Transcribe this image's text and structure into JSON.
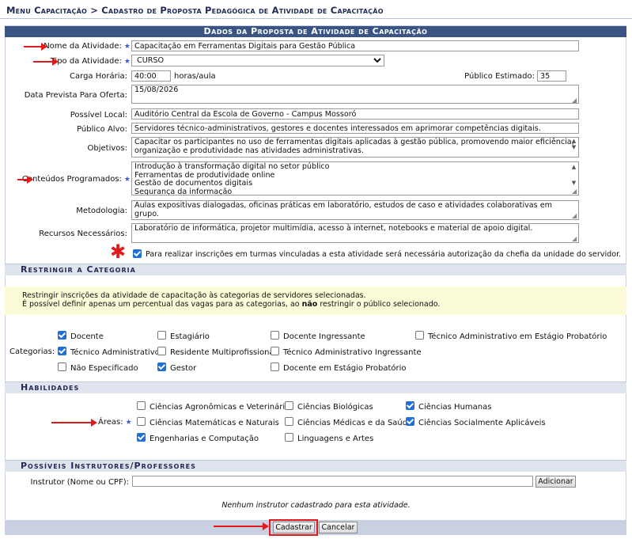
{
  "breadcrumb": "Menu Capacitação > Cadastro de Proposta Pedagógica de Atividade de Capacitação",
  "form": {
    "caption": "Dados da Proposta de Atividade de Capacitação",
    "required_marker": "★",
    "nome": {
      "label": "Nome da Atividade:",
      "value": "Capacitação em Ferramentas Digitais para Gestão Pública"
    },
    "tipo": {
      "label": "Tipo da Atividade:",
      "value": "CURSO"
    },
    "carga": {
      "label": "Carga Horária:",
      "value": "40:00",
      "unit": "horas/aula"
    },
    "publico_estimado": {
      "label": "Público Estimado:",
      "value": "35"
    },
    "data_prevista": {
      "label": "Data Prevista Para Oferta:",
      "value": "15/08/2026"
    },
    "local": {
      "label": "Possível Local:",
      "value": "Auditório Central da Escola de Governo - Campus Mossoró"
    },
    "publico_alvo": {
      "label": "Público Alvo:",
      "value": "Servidores técnico-administrativos, gestores e docentes interessados em aprimorar competências digitais."
    },
    "objetivos": {
      "label": "Objetivos:",
      "value": "Capacitar os participantes no uso de ferramentas digitais aplicadas à gestão pública, promovendo maior eficiência,\norganização e produtividade nas atividades administrativas."
    },
    "conteudos": {
      "label": "Conteúdos Programados:",
      "value": "Introdução à transformação digital no setor público\nFerramentas de produtividade online\nGestão de documentos digitais\nSegurança da informação"
    },
    "metodologia": {
      "label": "Metodologia:",
      "value": "Aulas expositivas dialogadas, oficinas práticas em laboratório, estudos de caso e atividades colaborativas em grupo."
    },
    "recursos": {
      "label": "Recursos Necessários:",
      "value": "Laboratório de informática, projetor multimídia, acesso à internet, notebooks e material de apoio digital."
    },
    "autorizacao": {
      "label": "Para realizar inscrições em turmas vinculadas a esta atividade será necessária autorização da chefia da unidade do servidor.",
      "checked": true
    }
  },
  "restringir": {
    "title": "Restringir a Categoria",
    "notice_line1": "Restringir inscrições da atividade de capacitação às categorias de servidores selecionadas.",
    "notice_line2_pre": "É possível definir apenas um percentual das vagas para as categorias, ao ",
    "notice_line2_bold": "não",
    "notice_line2_post": " restringir o público selecionado.",
    "categorias_label": "Categorias:",
    "options": [
      {
        "label": "Docente",
        "checked": true
      },
      {
        "label": "Estagiário",
        "checked": false
      },
      {
        "label": "Docente Ingressante",
        "checked": false
      },
      {
        "label": "Técnico Administrativo em Estágio Probatório",
        "checked": false
      },
      {
        "label": "Técnico Administrativo",
        "checked": true
      },
      {
        "label": "Residente Multiprofissional",
        "checked": false
      },
      {
        "label": "Técnico Administrativo Ingressante",
        "checked": false
      },
      {
        "label": "Não Especificado",
        "checked": false
      },
      {
        "label": "Gestor",
        "checked": true
      },
      {
        "label": "Docente em Estágio Probatório",
        "checked": false
      }
    ]
  },
  "habilidades": {
    "title": "Habilidades",
    "areas_label": "Áreas:",
    "options": [
      {
        "label": "Ciências Agronômicas e Veterinárias",
        "checked": false
      },
      {
        "label": "Ciências Biológicas",
        "checked": false
      },
      {
        "label": "Ciências Humanas",
        "checked": true
      },
      {
        "label": "Ciências Matemáticas e Naturais",
        "checked": false
      },
      {
        "label": "Ciências Médicas e da Saúde",
        "checked": false
      },
      {
        "label": "Ciências Socialmente Aplicáveis",
        "checked": true
      },
      {
        "label": "Engenharias e Computação",
        "checked": true
      },
      {
        "label": "Linguagens e Artes",
        "checked": false
      }
    ]
  },
  "instrutores": {
    "title": "Possíveis Instrutores/Professores",
    "label": "Instrutor (Nome ou CPF):",
    "value": "",
    "add_button": "Adicionar",
    "empty_message": "Nenhum instrutor cadastrado para esta atividade."
  },
  "actions": {
    "submit": "Cadastrar",
    "cancel": "Cancelar"
  },
  "colors": {
    "caption_bg": "#3a5584",
    "section_bg": "#dfe4ee",
    "notice_bg": "#fcfbd8",
    "annotation_red": "#e01b1b",
    "required_blue": "#3b5bd9",
    "checkbox_blue": "#1e6fd8"
  }
}
